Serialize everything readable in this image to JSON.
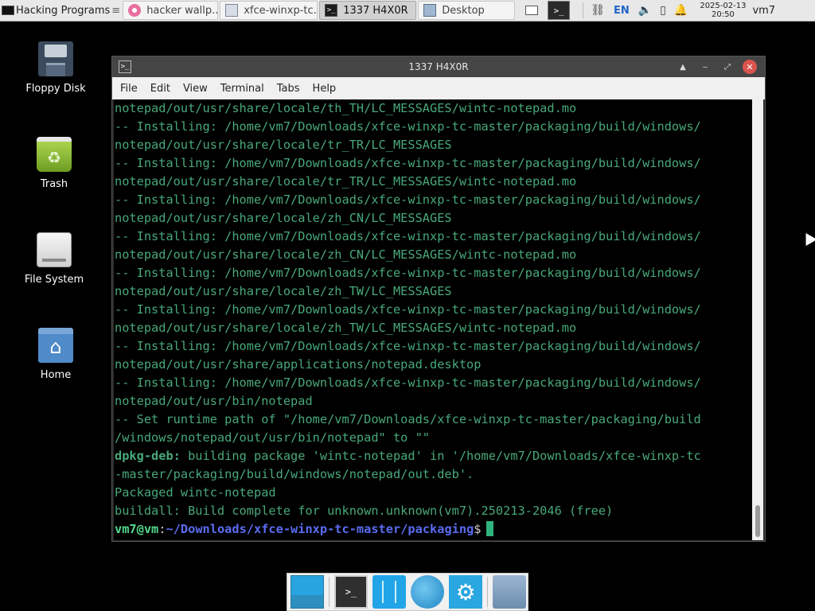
{
  "top_panel": {
    "app_menu_label": "Hacking Programs",
    "tasks": [
      {
        "label": "hacker wallp...",
        "icon": "browser-icon",
        "active": false
      },
      {
        "label": "xfce-winxp-tc...",
        "icon": "folder-icon",
        "active": false
      },
      {
        "label": "1337 H4X0R",
        "icon": "terminal-icon",
        "active": true
      },
      {
        "label": "Desktop",
        "icon": "desktop-icon",
        "active": false
      }
    ],
    "tray": {
      "language": "EN",
      "date": "2025-02-13",
      "time": "20:50",
      "user": "vm7"
    }
  },
  "desktop_icons": [
    {
      "label": "Floppy Disk",
      "icon": "floppy-disk-icon"
    },
    {
      "label": "Trash",
      "icon": "trash-icon"
    },
    {
      "label": "File System",
      "icon": "file-system-icon"
    },
    {
      "label": "Home",
      "icon": "home-folder-icon"
    }
  ],
  "terminal": {
    "title": "1337 H4X0R",
    "menu": [
      "File",
      "Edit",
      "View",
      "Terminal",
      "Tabs",
      "Help"
    ],
    "lines": [
      "notepad/out/usr/share/locale/th_TH/LC_MESSAGES/wintc-notepad.mo",
      "-- Installing: /home/vm7/Downloads/xfce-winxp-tc-master/packaging/build/windows/",
      "notepad/out/usr/share/locale/tr_TR/LC_MESSAGES",
      "-- Installing: /home/vm7/Downloads/xfce-winxp-tc-master/packaging/build/windows/",
      "notepad/out/usr/share/locale/tr_TR/LC_MESSAGES/wintc-notepad.mo",
      "-- Installing: /home/vm7/Downloads/xfce-winxp-tc-master/packaging/build/windows/",
      "notepad/out/usr/share/locale/zh_CN/LC_MESSAGES",
      "-- Installing: /home/vm7/Downloads/xfce-winxp-tc-master/packaging/build/windows/",
      "notepad/out/usr/share/locale/zh_CN/LC_MESSAGES/wintc-notepad.mo",
      "-- Installing: /home/vm7/Downloads/xfce-winxp-tc-master/packaging/build/windows/",
      "notepad/out/usr/share/locale/zh_TW/LC_MESSAGES",
      "-- Installing: /home/vm7/Downloads/xfce-winxp-tc-master/packaging/build/windows/",
      "notepad/out/usr/share/locale/zh_TW/LC_MESSAGES/wintc-notepad.mo",
      "-- Installing: /home/vm7/Downloads/xfce-winxp-tc-master/packaging/build/windows/",
      "notepad/out/usr/share/applications/notepad.desktop",
      "-- Installing: /home/vm7/Downloads/xfce-winxp-tc-master/packaging/build/windows/",
      "notepad/out/usr/bin/notepad",
      "-- Set runtime path of \"/home/vm7/Downloads/xfce-winxp-tc-master/packaging/build",
      "/windows/notepad/out/usr/bin/notepad\" to \"\""
    ],
    "dpkg_label": "dpkg-deb:",
    "dpkg_rest": " building package 'wintc-notepad' in '/home/vm7/Downloads/xfce-winxp-tc",
    "dpkg_line2": "-master/packaging/build/windows/notepad/out.deb'.",
    "packaged_line": "Packaged wintc-notepad",
    "build_line": "buildall: Build complete for unknown.unknown(vm7).250213-2046 (free)",
    "prompt_user": "vm7@vm",
    "prompt_sep": ":",
    "prompt_path": "~/Downloads/xfce-winxp-tc-master/packaging",
    "prompt_dollar": "$"
  },
  "dock": [
    {
      "icon": "show-desktop-icon"
    },
    {
      "icon": "terminal-icon"
    },
    {
      "icon": "file-manager-icon"
    },
    {
      "icon": "web-browser-icon"
    },
    {
      "icon": "settings-icon"
    },
    {
      "icon": "folder-icon"
    }
  ]
}
